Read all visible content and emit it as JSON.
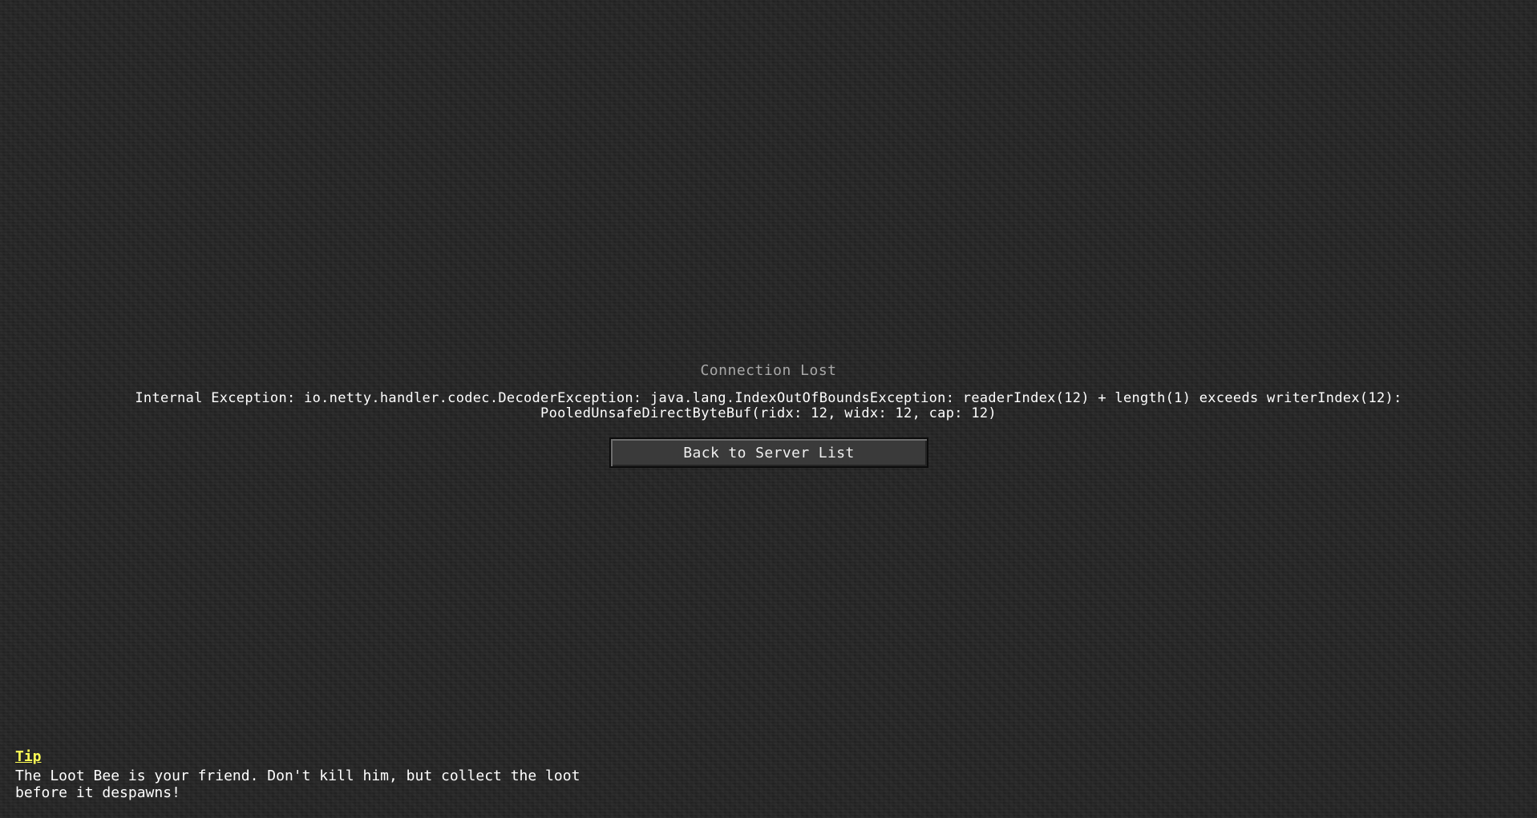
{
  "screen": {
    "title": "Connection Lost",
    "error_lines": [
      "Internal Exception: io.netty.handler.codec.DecoderException: java.lang.IndexOutOfBoundsException: readerIndex(12) + length(1) exceeds writerIndex(12):",
      "PooledUnsafeDirectByteBuf(ridx: 12, widx: 12, cap: 12)"
    ],
    "back_button_label": "Back to Server List"
  },
  "tip": {
    "label": "Tip",
    "lines": [
      "The Loot Bee is your friend. Don't kill him, but collect the loot",
      "before it despawns!"
    ]
  },
  "colors": {
    "background": "#252525",
    "title_text": "#a8a8a8",
    "tip_label": "#ffff55",
    "body_text": "#ffffff"
  }
}
